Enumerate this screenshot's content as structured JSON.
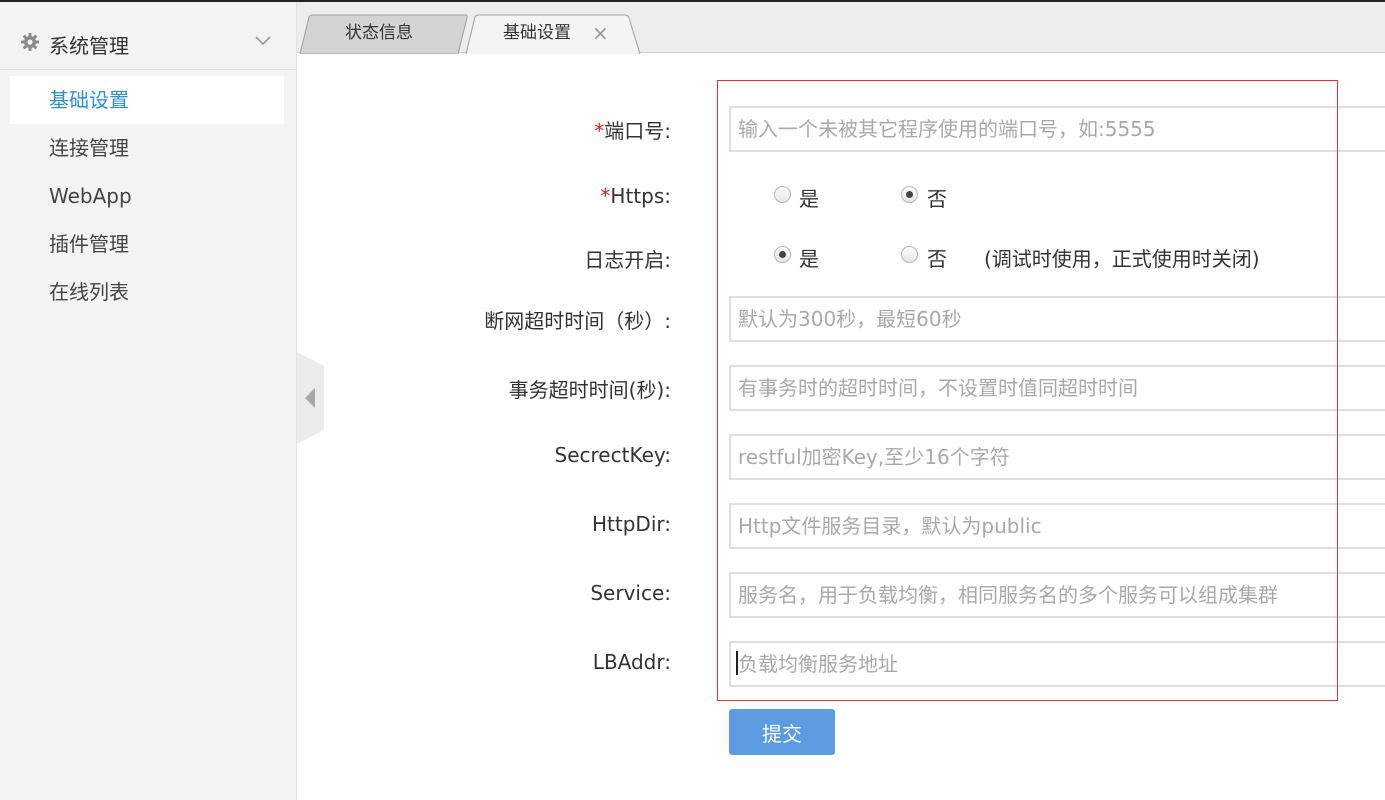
{
  "sidebar": {
    "header": {
      "title": "系统管理",
      "icon": "gear-icon"
    },
    "items": [
      {
        "label": "基础设置",
        "active": true
      },
      {
        "label": "连接管理",
        "active": false
      },
      {
        "label": "WebApp",
        "active": false
      },
      {
        "label": "插件管理",
        "active": false
      },
      {
        "label": "在线列表",
        "active": false
      }
    ]
  },
  "tabs": [
    {
      "label": "状态信息",
      "active": false
    },
    {
      "label": "基础设置",
      "active": true,
      "close": "×"
    }
  ],
  "form": {
    "required_mark": "*",
    "port": {
      "label": "端口号:",
      "placeholder": "输入一个未被其它程序使用的端口号，如:5555"
    },
    "https": {
      "label": "Https:",
      "yes": "是",
      "no": "否",
      "selected": "no"
    },
    "log": {
      "label": "日志开启:",
      "yes": "是",
      "no": "否",
      "selected": "yes",
      "note": "(调试时使用，正式使用时关闭)"
    },
    "disconnect_timeout": {
      "label": "断网超时时间（秒）:",
      "placeholder": "默认为300秒，最短60秒"
    },
    "transaction_timeout": {
      "label": "事务超时时间(秒):",
      "placeholder": "有事务时的超时时间，不设置时值同超时时间"
    },
    "secret_key": {
      "label": "SecrectKey:",
      "placeholder": "restful加密Key,至少16个字符"
    },
    "http_dir": {
      "label": "HttpDir:",
      "placeholder": "Http文件服务目录，默认为public"
    },
    "service": {
      "label": "Service:",
      "placeholder": "服务名，用于负载均衡，相同服务名的多个服务可以组成集群"
    },
    "lb_addr": {
      "label": "LBAddr:",
      "placeholder": "负载均衡服务地址"
    },
    "submit_label": "提交"
  },
  "colors": {
    "accent": "#2d8fd5",
    "button": "#5b9ce0",
    "required": "#e02020",
    "highlight_box": "#d9363e"
  }
}
